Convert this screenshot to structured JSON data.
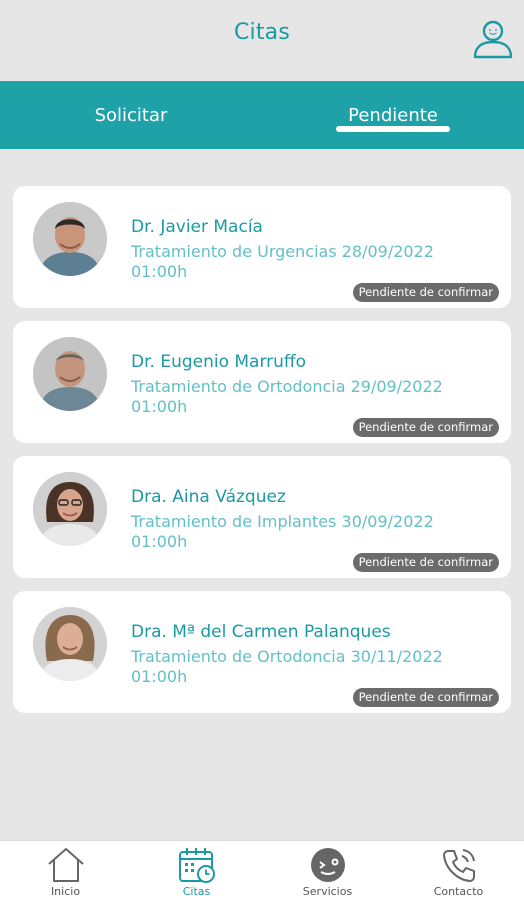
{
  "header": {
    "title": "Citas",
    "profile_icon": "user-profile-icon"
  },
  "tabs": [
    {
      "label": "Solicitar",
      "active": false
    },
    {
      "label": "Pendiente",
      "active": true
    }
  ],
  "appointments": [
    {
      "doctor": "Dr. Javier Macía",
      "treatment": "Tratamiento de Urgencias 28/09/2022",
      "time": "01:00h",
      "status": "Pendiente de confirmar"
    },
    {
      "doctor": "Dr. Eugenio Marruffo",
      "treatment": "Tratamiento de Ortodoncia 29/09/2022",
      "time": "01:00h",
      "status": "Pendiente de confirmar"
    },
    {
      "doctor": "Dra. Aina Vázquez",
      "treatment": "Tratamiento de Implantes 30/09/2022",
      "time": "01:00h",
      "status": "Pendiente de confirmar"
    },
    {
      "doctor": "Dra. Mª del Carmen Palanques",
      "treatment": "Tratamiento de Ortodoncia 30/11/2022",
      "time": "01:00h",
      "status": "Pendiente de confirmar"
    }
  ],
  "bottom_nav": [
    {
      "label": "Inicio",
      "icon": "home-icon",
      "active": false
    },
    {
      "label": "Citas",
      "icon": "calendar-clock-icon",
      "active": true
    },
    {
      "label": "Servicios",
      "icon": "smile-icon",
      "active": false
    },
    {
      "label": "Contacto",
      "icon": "phone-icon",
      "active": false
    }
  ],
  "colors": {
    "accent": "#1b9aa3",
    "tabbar": "#1fa1a8",
    "secondary_text": "#62c0c6",
    "badge": "#6b6b6b",
    "background": "#e6e6e6"
  }
}
